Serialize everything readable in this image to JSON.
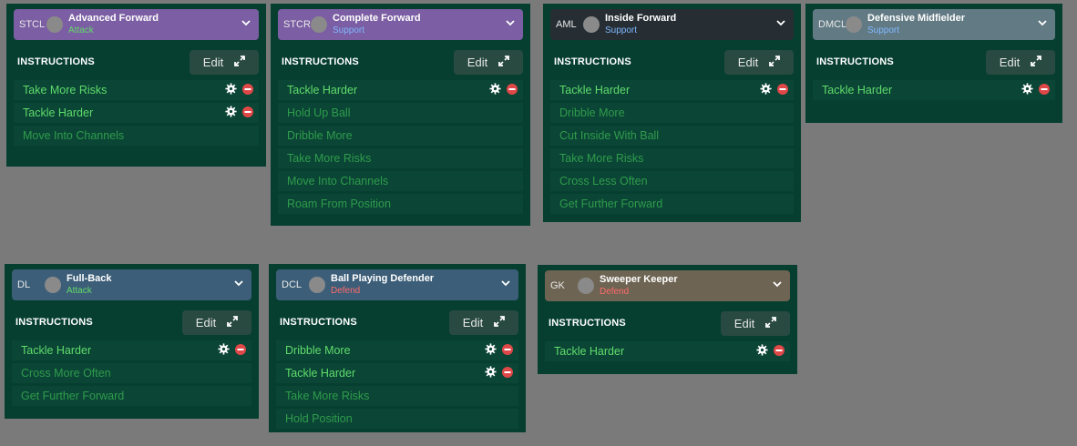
{
  "edit_label": "Edit",
  "instructions_label": "INSTRUCTIONS",
  "panels": [
    {
      "position": "STCL",
      "role": "Advanced Forward",
      "duty": "Attack",
      "duty_class": "attack",
      "header_color": "#7b5ea3",
      "instructions": [
        {
          "label": "Take More Risks",
          "active": true
        },
        {
          "label": "Tackle Harder",
          "active": true
        },
        {
          "label": "Move Into Channels",
          "active": false
        }
      ]
    },
    {
      "position": "STCR",
      "role": "Complete Forward",
      "duty": "Support",
      "duty_class": "support",
      "header_color": "#7b5ea3",
      "instructions": [
        {
          "label": "Tackle Harder",
          "active": true
        },
        {
          "label": "Hold Up Ball",
          "active": false
        },
        {
          "label": "Dribble More",
          "active": false
        },
        {
          "label": "Take More Risks",
          "active": false
        },
        {
          "label": "Move Into Channels",
          "active": false
        },
        {
          "label": "Roam From Position",
          "active": false
        }
      ]
    },
    {
      "position": "AML",
      "role": "Inside Forward",
      "duty": "Support",
      "duty_class": "support",
      "header_color": "#262d33",
      "instructions": [
        {
          "label": "Tackle Harder",
          "active": true
        },
        {
          "label": "Dribble More",
          "active": false
        },
        {
          "label": "Cut Inside With Ball",
          "active": false
        },
        {
          "label": "Take More Risks",
          "active": false
        },
        {
          "label": "Cross Less Often",
          "active": false
        },
        {
          "label": "Get Further Forward",
          "active": false
        }
      ]
    },
    {
      "position": "DMCL",
      "role": "Defensive Midfielder",
      "duty": "Support",
      "duty_class": "support",
      "header_color": "#627a84",
      "instructions": [
        {
          "label": "Tackle Harder",
          "active": true
        }
      ]
    },
    {
      "position": "DL",
      "role": "Full-Back",
      "duty": "Attack",
      "duty_class": "attack",
      "header_color": "#3c5e78",
      "instructions": [
        {
          "label": "Tackle Harder",
          "active": true
        },
        {
          "label": "Cross More Often",
          "active": false
        },
        {
          "label": "Get Further Forward",
          "active": false
        }
      ]
    },
    {
      "position": "DCL",
      "role": "Ball Playing Defender",
      "duty": "Defend",
      "duty_class": "defend",
      "header_color": "#3c5e78",
      "instructions": [
        {
          "label": "Dribble More",
          "active": true
        },
        {
          "label": "Tackle Harder",
          "active": true
        },
        {
          "label": "Take More Risks",
          "active": false
        },
        {
          "label": "Hold Position",
          "active": false
        }
      ]
    },
    {
      "position": "GK",
      "role": "Sweeper Keeper",
      "duty": "Defend",
      "duty_class": "defend",
      "header_color": "#6e6453",
      "instructions": [
        {
          "label": "Tackle Harder",
          "active": true
        }
      ]
    }
  ]
}
